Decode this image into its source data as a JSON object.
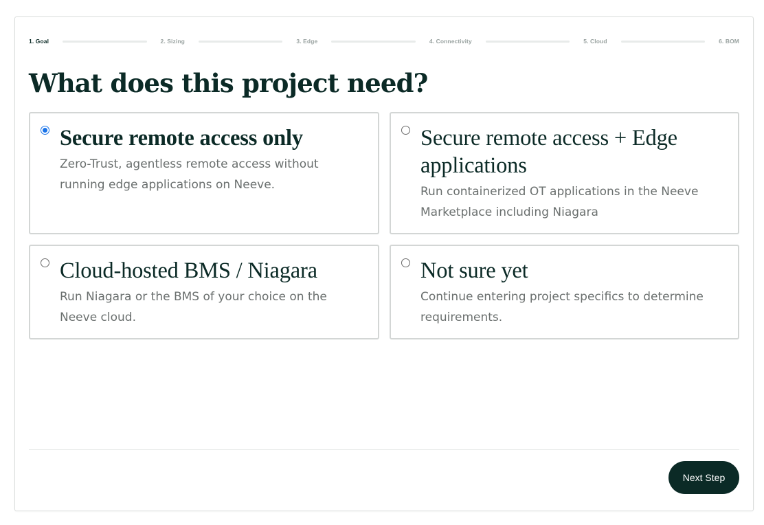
{
  "wizard": {
    "steps": [
      {
        "label": "1. Goal",
        "active": true
      },
      {
        "label": "2. Sizing",
        "active": false
      },
      {
        "label": "3. Edge",
        "active": false
      },
      {
        "label": "4. Connectivity",
        "active": false
      },
      {
        "label": "5. Cloud",
        "active": false
      },
      {
        "label": "6. BOM",
        "active": false
      }
    ]
  },
  "page": {
    "title": "What does this project need?"
  },
  "options": [
    {
      "title": "Secure remote access only",
      "description": "Zero-Trust, agentless remote access without running edge applications on Neeve.",
      "selected": true
    },
    {
      "title": "Secure remote access + Edge applications",
      "description": "Run containerized OT applications in the Neeve Marketplace including Niagara",
      "selected": false
    },
    {
      "title": "Cloud-hosted BMS / Niagara",
      "description": "Run Niagara or the BMS of your choice on the Neeve cloud.",
      "selected": false
    },
    {
      "title": "Not sure yet",
      "description": "Continue entering project specifics to determine requirements.",
      "selected": false
    }
  ],
  "footer": {
    "next_label": "Next Step"
  },
  "colors": {
    "brand_dark": "#0b2a26",
    "radio_selected": "#1a73e8",
    "muted_text": "#6a6f6e"
  }
}
